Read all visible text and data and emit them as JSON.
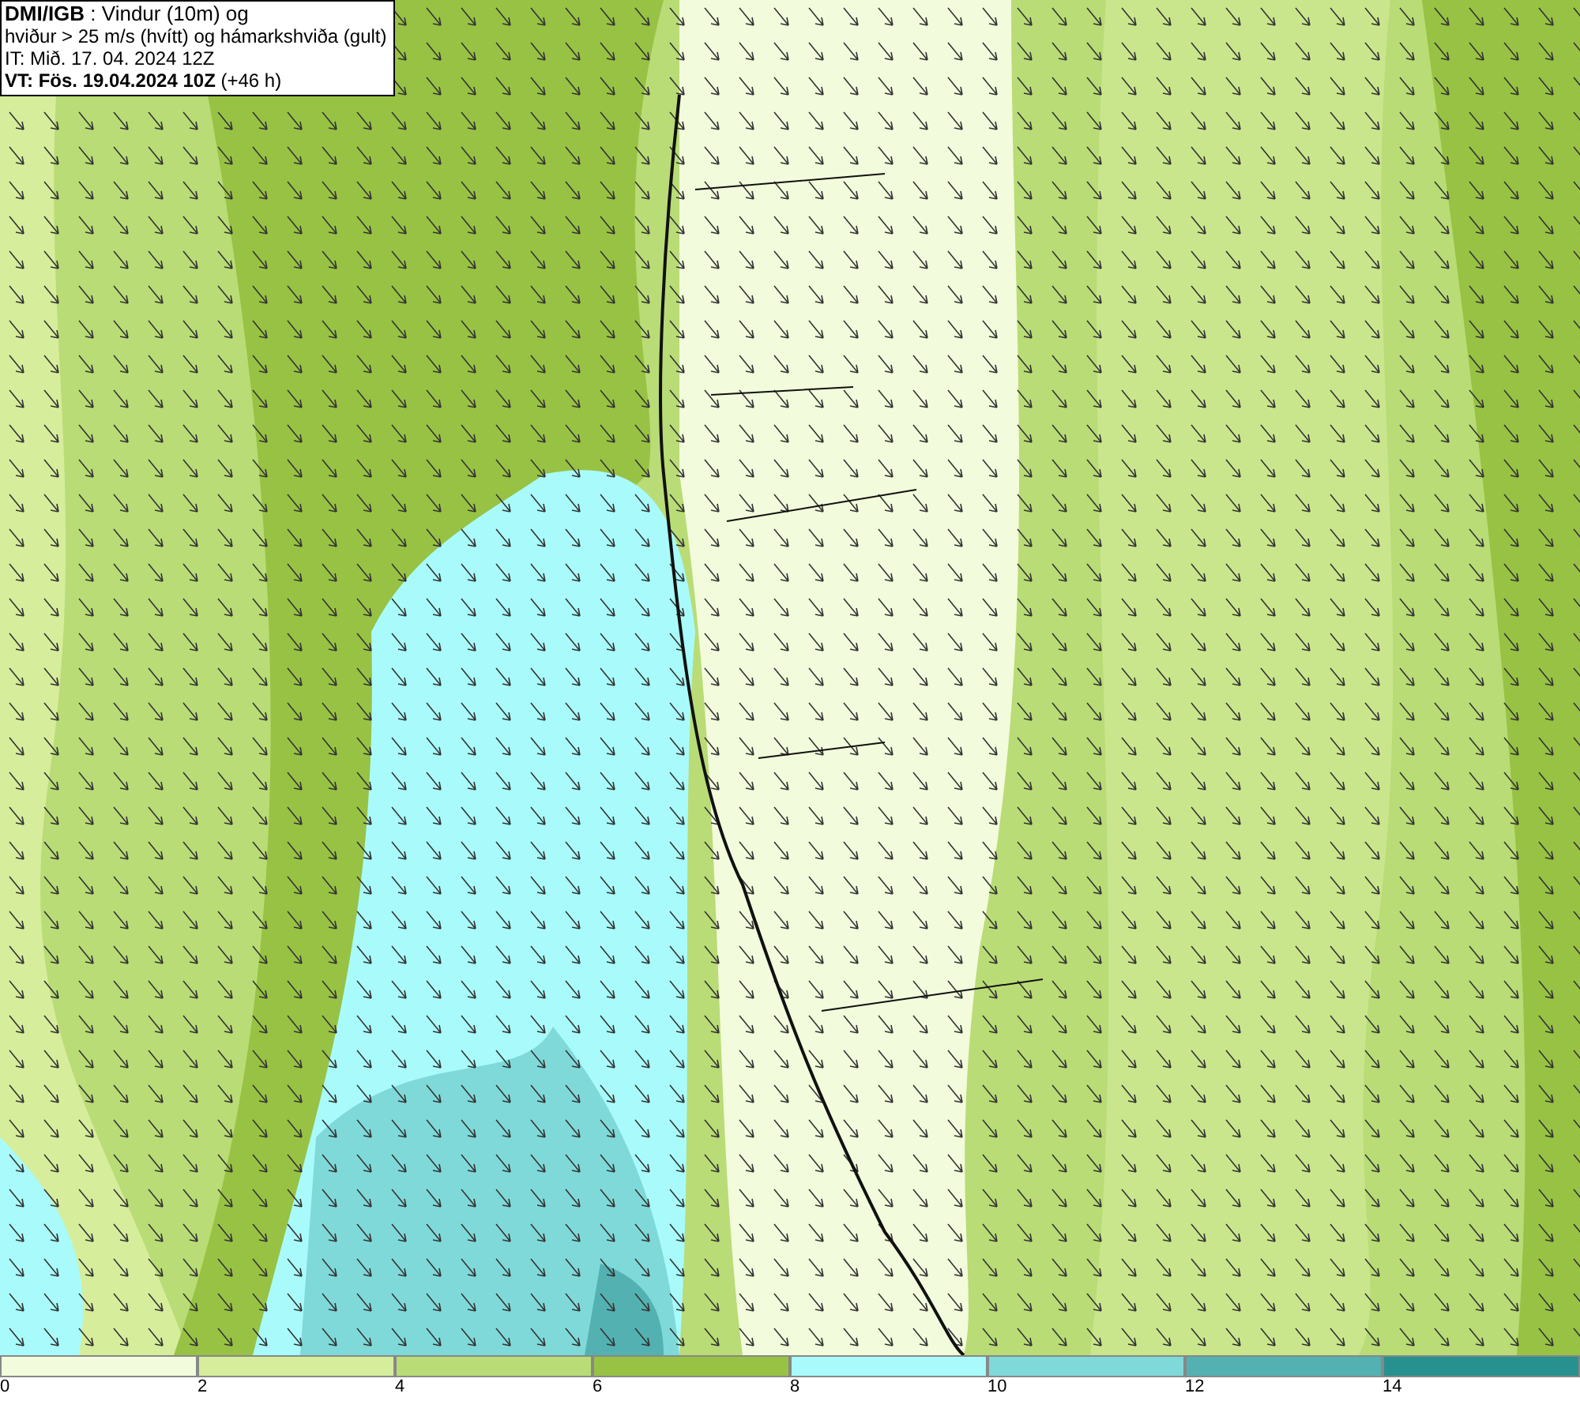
{
  "info_box": {
    "lines": [
      "**DMI/IGB** : Vindur (10m) og",
      "hviður > 25 m/s (hvítt) og hámarkshviða (gult)",
      "IT: Mið. 17. 04. 2024 12Z",
      "**VT: Fös. 19.04.2024 10Z** (+46 h)"
    ]
  },
  "color_scale": [
    {
      "label": "0",
      "color": "#f2fbdb"
    },
    {
      "label": "2",
      "color": "#d6ed9c"
    },
    {
      "label": "4",
      "color": "#b9dc76"
    },
    {
      "label": "6",
      "color": "#98c244"
    },
    {
      "label": "8",
      "color": "#a8fbfa"
    },
    {
      "label": "10",
      "color": "#80d9d9"
    },
    {
      "label": "12",
      "color": "#54b1b1"
    },
    {
      "label": "14",
      "color": "#27918f"
    }
  ]
}
